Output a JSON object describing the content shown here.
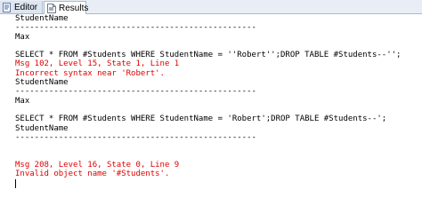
{
  "tabs": {
    "editor_label": "Editor",
    "results_label": "Results"
  },
  "output_lines": [
    {
      "text": "StudentName",
      "kind": "normal"
    },
    {
      "text": "--------------------------------------------------",
      "kind": "normal"
    },
    {
      "text": "Max",
      "kind": "normal"
    },
    {
      "text": "",
      "kind": "normal"
    },
    {
      "text": "SELECT * FROM #Students WHERE StudentName = ''Robert'';DROP TABLE #Students--'';",
      "kind": "normal"
    },
    {
      "text": "Msg 102, Level 15, State 1, Line 1",
      "kind": "error"
    },
    {
      "text": "Incorrect syntax near 'Robert'.",
      "kind": "error"
    },
    {
      "text": "StudentName",
      "kind": "normal"
    },
    {
      "text": "--------------------------------------------------",
      "kind": "normal"
    },
    {
      "text": "Max",
      "kind": "normal"
    },
    {
      "text": "",
      "kind": "normal"
    },
    {
      "text": "SELECT * FROM #Students WHERE StudentName = 'Robert';DROP TABLE #Students--';",
      "kind": "normal"
    },
    {
      "text": "StudentName",
      "kind": "normal"
    },
    {
      "text": "--------------------------------------------------",
      "kind": "normal"
    },
    {
      "text": "",
      "kind": "normal"
    },
    {
      "text": "",
      "kind": "normal"
    },
    {
      "text": "Msg 208, Level 16, State 0, Line 9",
      "kind": "error"
    },
    {
      "text": "Invalid object name '#Students'.",
      "kind": "error"
    }
  ],
  "colors": {
    "error_text": "#e00000",
    "normal_text": "#000000"
  }
}
